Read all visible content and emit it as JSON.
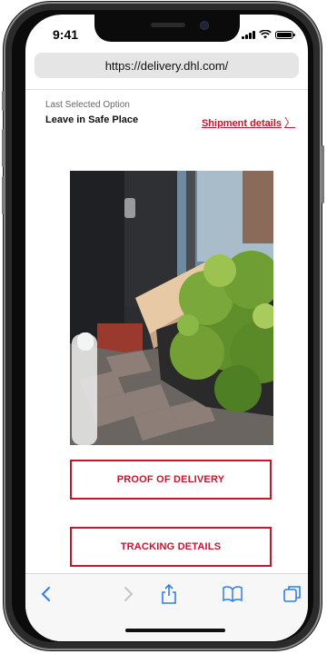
{
  "status_bar": {
    "time": "9:41"
  },
  "browser": {
    "url": "https://delivery.dhl.com/"
  },
  "delivery": {
    "last_selected_label": "Last Selected Option",
    "last_selected_value": "Leave in Safe Place",
    "shipment_details_link": "Shipment details"
  },
  "actions": {
    "proof_of_delivery": "PROOF OF DELIVERY",
    "tracking_details": "TRACKING DETAILS"
  },
  "colors": {
    "accent": "#c7152c",
    "toolbar_icon": "#2f7bf6"
  },
  "toolbar": {
    "icons": [
      "back-icon",
      "forward-icon",
      "share-icon",
      "bookmarks-icon",
      "tabs-icon"
    ]
  }
}
